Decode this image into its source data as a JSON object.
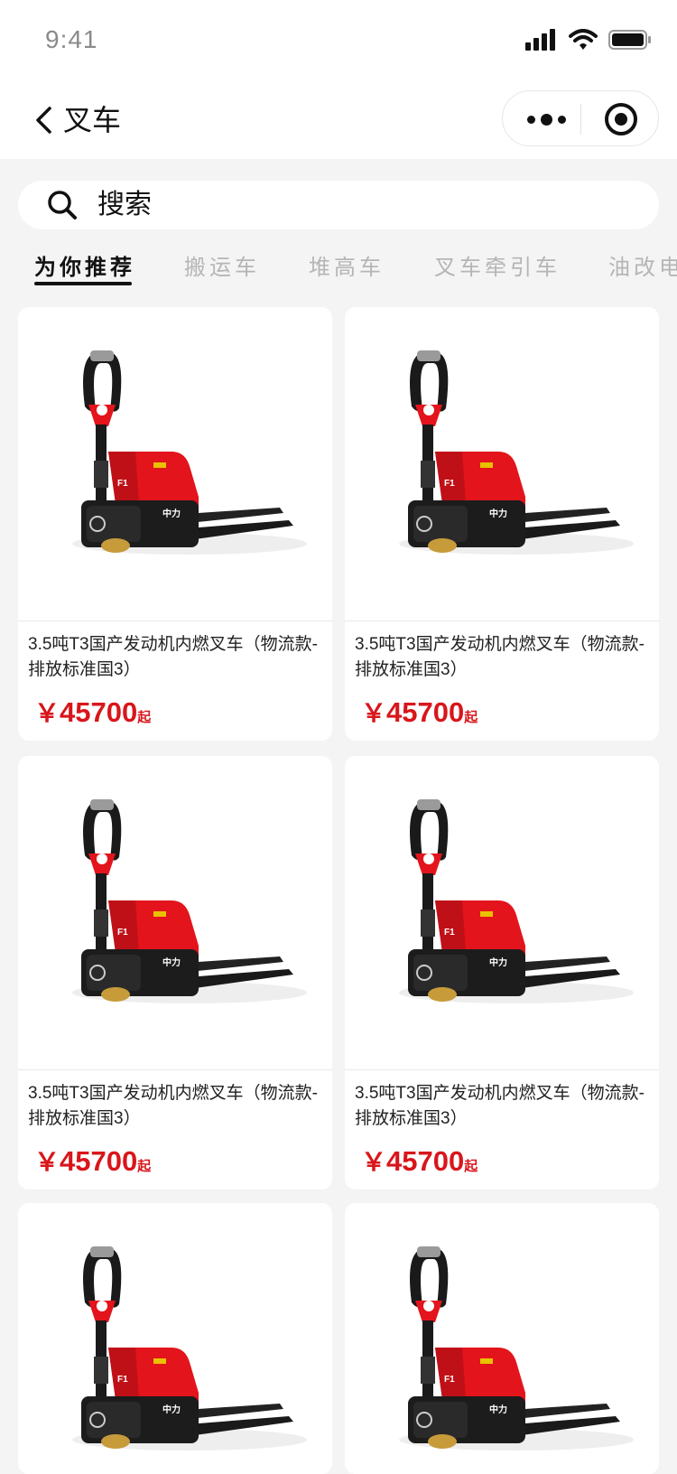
{
  "status_bar": {
    "time": "9:41"
  },
  "nav": {
    "title": "叉车"
  },
  "search": {
    "placeholder": "搜索"
  },
  "tabs": [
    {
      "label": "为你推荐",
      "active": true
    },
    {
      "label": "搬运车",
      "active": false
    },
    {
      "label": "堆高车",
      "active": false
    },
    {
      "label": "叉车牵引车",
      "active": false
    },
    {
      "label": "油改电",
      "active": false
    }
  ],
  "products": [
    {
      "title": "3.5吨T3国产发动机内燃叉车（物流款-排放标准国3）",
      "currency": "￥",
      "price": "45700",
      "suffix": "起"
    },
    {
      "title": "3.5吨T3国产发动机内燃叉车（物流款-排放标准国3）",
      "currency": "￥",
      "price": "45700",
      "suffix": "起"
    },
    {
      "title": "3.5吨T3国产发动机内燃叉车（物流款-排放标准国3）",
      "currency": "￥",
      "price": "45700",
      "suffix": "起"
    },
    {
      "title": "3.5吨T3国产发动机内燃叉车（物流款-排放标准国3）",
      "currency": "￥",
      "price": "45700",
      "suffix": "起"
    },
    {
      "title": "",
      "currency": "",
      "price": "",
      "suffix": ""
    },
    {
      "title": "",
      "currency": "",
      "price": "",
      "suffix": ""
    }
  ],
  "product_image": {
    "label_top": "F1",
    "label_side": "中力"
  },
  "colors": {
    "accent": "#d8161b",
    "product_red": "#e3141c"
  }
}
